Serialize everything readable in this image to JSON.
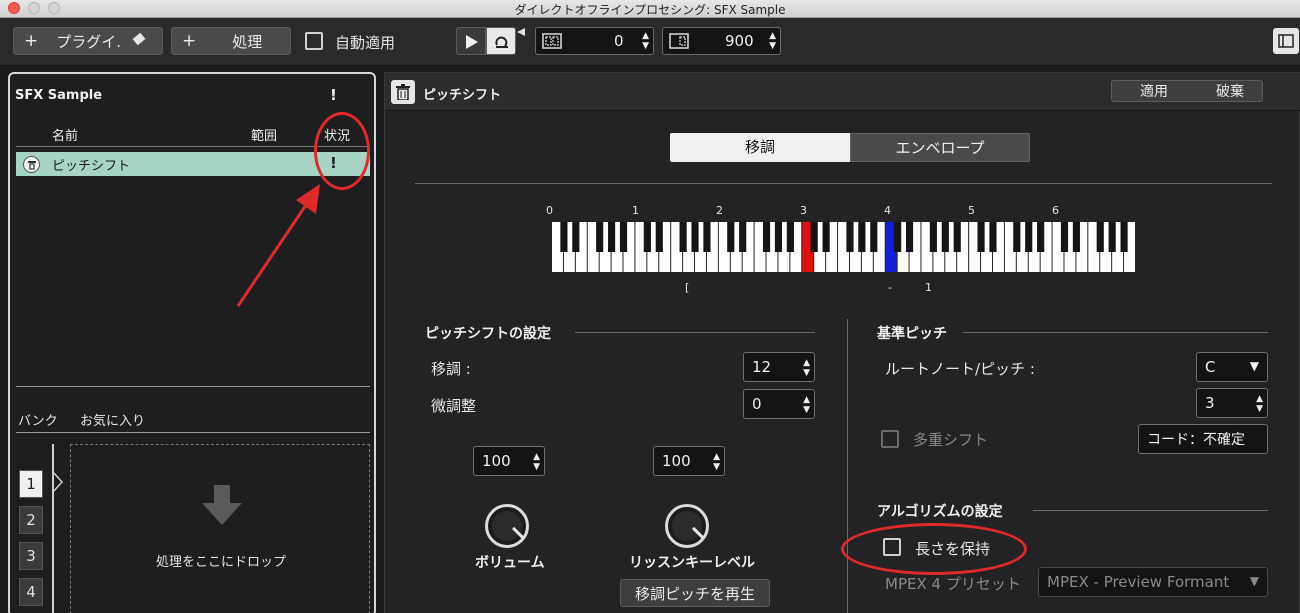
{
  "window": {
    "title": "ダイレクトオフラインプロセシング: SFX Sample"
  },
  "toolbar": {
    "plugin_label": "プラグイ.",
    "plugin_plus": "+",
    "process_plus": "+",
    "process_label": "処理",
    "auto_apply_label": "自動適用",
    "pre_value": "0",
    "post_value": "900"
  },
  "left": {
    "title": "SFX Sample",
    "title_warn": "!",
    "col_name": "名前",
    "col_range": "範囲",
    "col_status": "状況",
    "row_name": "ピッチシフト",
    "row_status": "!",
    "bank_label": "バンク",
    "favorites_label": "お気に入り",
    "banks": [
      "1",
      "2",
      "3",
      "4"
    ],
    "drop_label": "処理をここにドロップ"
  },
  "right": {
    "title": "ピッチシフト",
    "apply_label": "適用",
    "discard_label": "破棄",
    "tab_transpose": "移調",
    "tab_envelope": "エンベロープ",
    "octaves": [
      "0",
      "1",
      "2",
      "3",
      "4",
      "5",
      "6"
    ],
    "bracket_left": "[",
    "range_dash": "-",
    "range_end": "1",
    "pitch_settings_title": "ピッチシフトの設定",
    "transpose_label": "移調 :",
    "transpose_value": "12",
    "fine_label": "微調整",
    "fine_value": "0",
    "volume_value": "100",
    "listen_value": "100",
    "volume_label": "ボリューム",
    "listen_label": "リッスンキーレベル",
    "play_pitch_label": "移調ピッチを再生",
    "base_pitch_title": "基準ピッチ",
    "root_note_label": "ルートノート/ピッチ :",
    "root_note_value": "C",
    "root_octave_value": "3",
    "multi_shift_label": "多重シフト",
    "chord_label": "コード：不確定",
    "algorithm_title": "アルゴリズムの設定",
    "keep_length_label": "長さを保持",
    "mpex_label": "MPEX 4 プリセット",
    "mpex_value": "MPEX - Preview Formant"
  },
  "colors": {
    "row_highlight": "#a6d6c3",
    "key_red": "#e01010",
    "key_blue": "#1020d8",
    "annotation_red": "#e02a2a"
  }
}
